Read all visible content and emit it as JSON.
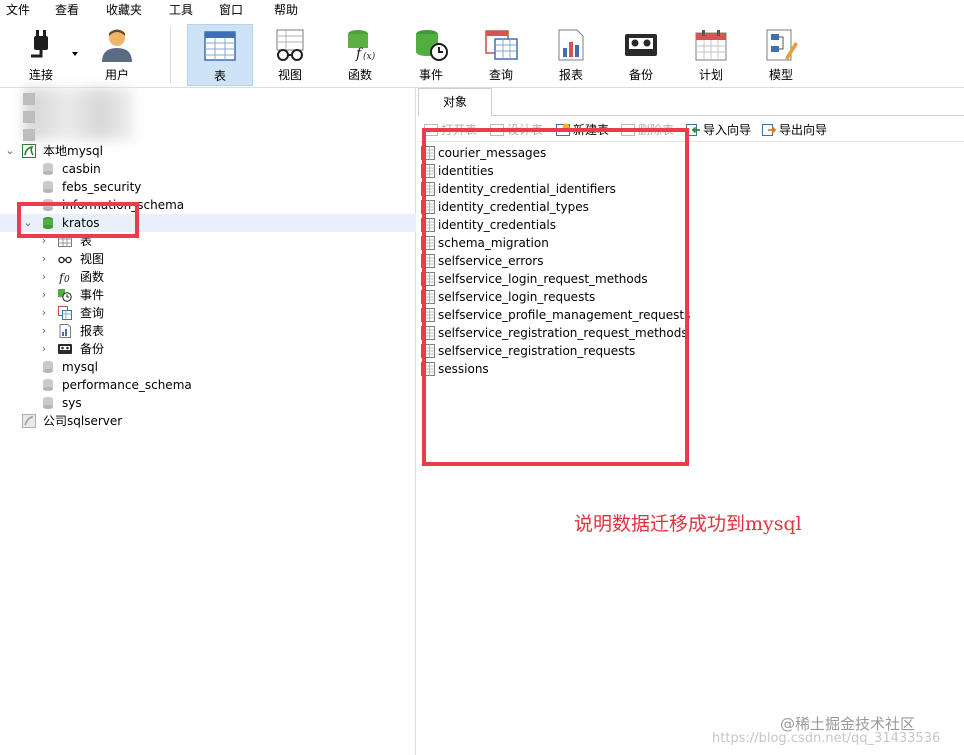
{
  "menu": [
    "文件",
    "查看",
    "收藏夹",
    "工具",
    "窗口",
    "帮助"
  ],
  "toolbar": {
    "connect": "连接",
    "user": "用户",
    "table": "表",
    "view": "视图",
    "function": "函数",
    "event": "事件",
    "query": "查询",
    "report": "报表",
    "backup": "备份",
    "schedule": "计划",
    "model": "模型"
  },
  "tree": {
    "local_mysql": "本地mysql",
    "casbin": "casbin",
    "febs_security": "febs_security",
    "information_schema": "information_schema",
    "kratos": "kratos",
    "kratos_children": {
      "tables": "表",
      "views": "视图",
      "functions": "函数",
      "events": "事件",
      "queries": "查询",
      "reports": "报表",
      "backups": "备份"
    },
    "mysql": "mysql",
    "performance_schema": "performance_schema",
    "sys": "sys",
    "company_sqlserver": "公司sqlserver"
  },
  "objects_tab": "对象",
  "object_toolbar": {
    "open_table": "打开表",
    "design_table": "设计表",
    "new_table": "新建表",
    "delete_table": "删除表",
    "import_wizard": "导入向导",
    "export_wizard": "导出向导"
  },
  "tables": [
    "courier_messages",
    "identities",
    "identity_credential_identifiers",
    "identity_credential_types",
    "identity_credentials",
    "schema_migration",
    "selfservice_errors",
    "selfservice_login_request_methods",
    "selfservice_login_requests",
    "selfservice_profile_management_requests",
    "selfservice_registration_request_methods",
    "selfservice_registration_requests",
    "sessions"
  ],
  "annotation": "说明数据迁移成功到mysql",
  "watermark": {
    "brand": "@稀土掘金技术社区",
    "url": "https://blog.csdn.net/qq_31433536"
  },
  "colors": {
    "highlight_box": "#ec3b4b",
    "selected_row": "#e8f1fb",
    "active_tool": "#cfe3f7"
  }
}
